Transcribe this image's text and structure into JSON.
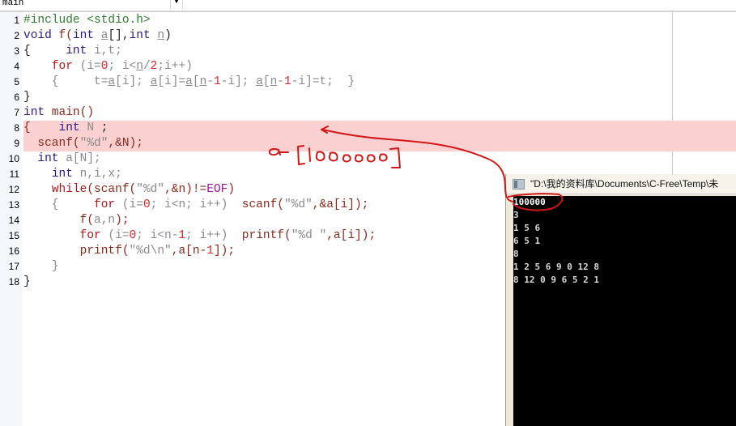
{
  "toolbar": {
    "function_select_value": "main",
    "dropdown_arrow": "▼"
  },
  "editor": {
    "highlighted_lines": [
      8,
      9
    ],
    "lines": [
      {
        "num": "1",
        "tokens": [
          {
            "t": "#include <stdio.h>",
            "c": "pp"
          }
        ]
      },
      {
        "num": "2",
        "tokens": [
          {
            "t": "void",
            "c": "kw"
          },
          {
            "t": " f(",
            "c": "fn"
          },
          {
            "t": "int",
            "c": "kw"
          },
          {
            "t": " ",
            "c": "pn"
          },
          {
            "t": "a",
            "c": "ul"
          },
          {
            "t": "[],",
            "c": "pn"
          },
          {
            "t": "int",
            "c": "kw"
          },
          {
            "t": " ",
            "c": "pn"
          },
          {
            "t": "n",
            "c": "ul"
          },
          {
            "t": ")",
            "c": "pn"
          }
        ]
      },
      {
        "num": "3",
        "tokens": [
          {
            "t": "{     ",
            "c": "pn"
          },
          {
            "t": "int",
            "c": "kw"
          },
          {
            "t": " i,t;",
            "c": "id"
          }
        ]
      },
      {
        "num": "4",
        "tokens": [
          {
            "t": "    ",
            "c": "pn"
          },
          {
            "t": "for",
            "c": "kw2"
          },
          {
            "t": " (i=",
            "c": "id"
          },
          {
            "t": "0",
            "c": "num-lit"
          },
          {
            "t": "; i<",
            "c": "id"
          },
          {
            "t": "n",
            "c": "ul"
          },
          {
            "t": "/",
            "c": "id"
          },
          {
            "t": "2",
            "c": "num-lit"
          },
          {
            "t": ";i++)",
            "c": "id"
          }
        ]
      },
      {
        "num": "5",
        "tokens": [
          {
            "t": "    {     t=",
            "c": "id"
          },
          {
            "t": "a",
            "c": "ul"
          },
          {
            "t": "[i]; ",
            "c": "id"
          },
          {
            "t": "a",
            "c": "ul"
          },
          {
            "t": "[i]=",
            "c": "id"
          },
          {
            "t": "a",
            "c": "ul"
          },
          {
            "t": "[",
            "c": "id"
          },
          {
            "t": "n",
            "c": "ul"
          },
          {
            "t": "-",
            "c": "id"
          },
          {
            "t": "1",
            "c": "num-lit"
          },
          {
            "t": "-i]; ",
            "c": "id"
          },
          {
            "t": "a",
            "c": "ul"
          },
          {
            "t": "[",
            "c": "id"
          },
          {
            "t": "n",
            "c": "ul"
          },
          {
            "t": "-",
            "c": "id"
          },
          {
            "t": "1",
            "c": "num-lit"
          },
          {
            "t": "-i]=t;  }",
            "c": "id"
          }
        ]
      },
      {
        "num": "6",
        "tokens": [
          {
            "t": "}",
            "c": "pn"
          }
        ]
      },
      {
        "num": "7",
        "tokens": [
          {
            "t": "int",
            "c": "kw"
          },
          {
            "t": " main()",
            "c": "fn"
          }
        ]
      },
      {
        "num": "8",
        "tokens": [
          {
            "t": "{",
            "c": "fn"
          },
          {
            "t": "    ",
            "c": "pn"
          },
          {
            "t": "int",
            "c": "kw"
          },
          {
            "t": " N ",
            "c": "id"
          },
          {
            "t": ";",
            "c": "pn"
          }
        ]
      },
      {
        "num": "9",
        "tokens": [
          {
            "t": "  scanf(",
            "c": "fn"
          },
          {
            "t": "\"%d\"",
            "c": "str"
          },
          {
            "t": ",&N);",
            "c": "fn"
          }
        ]
      },
      {
        "num": "10",
        "tokens": [
          {
            "t": "  ",
            "c": "pn"
          },
          {
            "t": "int",
            "c": "kw"
          },
          {
            "t": " a[N];",
            "c": "id"
          }
        ]
      },
      {
        "num": "11",
        "tokens": [
          {
            "t": "    ",
            "c": "pn"
          },
          {
            "t": "int",
            "c": "kw"
          },
          {
            "t": " n,i,x;",
            "c": "id"
          }
        ]
      },
      {
        "num": "12",
        "tokens": [
          {
            "t": "    ",
            "c": "pn"
          },
          {
            "t": "while",
            "c": "kw2"
          },
          {
            "t": "(scanf(",
            "c": "fn"
          },
          {
            "t": "\"%d\"",
            "c": "str"
          },
          {
            "t": ",&n)!=",
            "c": "fn"
          },
          {
            "t": "EOF",
            "c": "mac"
          },
          {
            "t": ")",
            "c": "fn"
          }
        ]
      },
      {
        "num": "13",
        "tokens": [
          {
            "t": "    {     ",
            "c": "id"
          },
          {
            "t": "for",
            "c": "kw2"
          },
          {
            "t": " (i=",
            "c": "id"
          },
          {
            "t": "0",
            "c": "num-lit"
          },
          {
            "t": "; i<n; i++)  ",
            "c": "id"
          },
          {
            "t": "scanf(",
            "c": "fn"
          },
          {
            "t": "\"%d\"",
            "c": "str"
          },
          {
            "t": ",&a[i]);",
            "c": "fn"
          }
        ]
      },
      {
        "num": "14",
        "tokens": [
          {
            "t": "        f(",
            "c": "fn"
          },
          {
            "t": "a,n",
            "c": "id"
          },
          {
            "t": ");",
            "c": "fn"
          }
        ]
      },
      {
        "num": "15",
        "tokens": [
          {
            "t": "        ",
            "c": "pn"
          },
          {
            "t": "for",
            "c": "kw2"
          },
          {
            "t": " (i=",
            "c": "id"
          },
          {
            "t": "0",
            "c": "num-lit"
          },
          {
            "t": "; i<n-",
            "c": "id"
          },
          {
            "t": "1",
            "c": "num-lit"
          },
          {
            "t": "; i++)  ",
            "c": "id"
          },
          {
            "t": "printf(",
            "c": "fn"
          },
          {
            "t": "\"%d \"",
            "c": "str"
          },
          {
            "t": ",a[i]);",
            "c": "fn"
          }
        ]
      },
      {
        "num": "16",
        "tokens": [
          {
            "t": "        printf(",
            "c": "fn"
          },
          {
            "t": "\"%d\\n\"",
            "c": "str"
          },
          {
            "t": ",a[n-",
            "c": "fn"
          },
          {
            "t": "1",
            "c": "num-lit"
          },
          {
            "t": "]);",
            "c": "fn"
          }
        ]
      },
      {
        "num": "17",
        "tokens": [
          {
            "t": "    }",
            "c": "id"
          }
        ]
      },
      {
        "num": "18",
        "tokens": [
          {
            "t": "}",
            "c": "pn"
          }
        ]
      }
    ]
  },
  "console": {
    "title": "\"D:\\我的资料库\\Documents\\C-Free\\Temp\\未",
    "lines": [
      "100000",
      "3",
      "1 5 6",
      "6 5 1",
      "8",
      "1 2 5 6 9 0 12 8",
      "8 12 0 9 6 5 2 1"
    ]
  },
  "annotation": {
    "handwritten_text": "a[100000]",
    "color": "#d01818"
  },
  "colors": {
    "highlight": "#fbd0d0",
    "console_bg": "#000000",
    "gutter_bg": "#f4f8fb"
  }
}
